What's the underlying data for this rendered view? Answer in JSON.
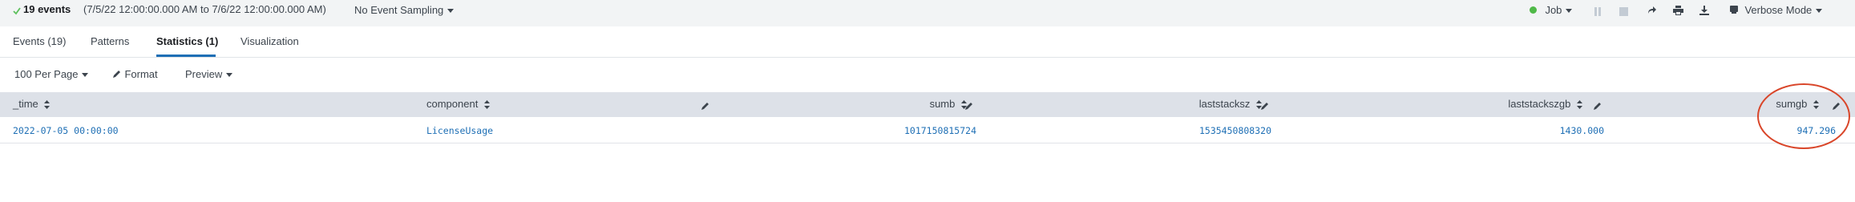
{
  "job_bar": {
    "event_count": "19 events",
    "time_range": "(7/5/22 12:00:00.000 AM to 7/6/22 12:00:00.000 AM)",
    "sampling": "No Event Sampling",
    "job_label": "Job",
    "mode_label": "Verbose Mode"
  },
  "tabs": [
    {
      "label": "Events (19)"
    },
    {
      "label": "Patterns"
    },
    {
      "label": "Statistics (1)"
    },
    {
      "label": "Visualization"
    }
  ],
  "toolbar": {
    "per_page": "100 Per Page",
    "format": "Format",
    "preview": "Preview"
  },
  "table": {
    "columns": [
      "_time",
      "component",
      "sumb",
      "laststacksz",
      "laststackszgb",
      "sumgb"
    ],
    "rows": [
      [
        "2022-07-05 00:00:00",
        "LicenseUsage",
        "1017150815724",
        "1535450808320",
        "1430.000",
        "947.296"
      ]
    ]
  },
  "colors": {
    "accent_blue": "#1e6fb5",
    "check_green": "#5cc05c",
    "status_dot_green": "#4fb948",
    "annotation_circle": "#d9462a",
    "header_bg": "#dde1e8"
  }
}
